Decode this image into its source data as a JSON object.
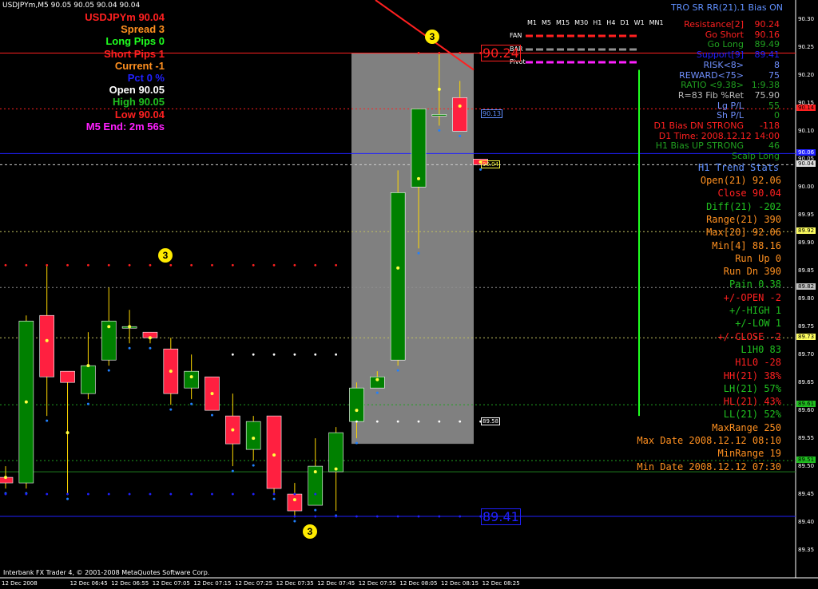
{
  "header": {
    "symbol_line": "USDJPYm,M5  90.05 90.05 90.04 90.04"
  },
  "left_panel": [
    {
      "text": "USDJPYm 90.04",
      "color": "#ff2020"
    },
    {
      "text": "Spread 3",
      "color": "#ff9020"
    },
    {
      "text": "Long Pips 0",
      "color": "#20ff20"
    },
    {
      "text": "Short Pips 1",
      "color": "#ff2020"
    },
    {
      "text": "Current -1",
      "color": "#ff9020"
    },
    {
      "text": "Pct 0 %",
      "color": "#2020ff"
    },
    {
      "text": "Open 90.05",
      "color": "#ffffff"
    },
    {
      "text": "High 90.05",
      "color": "#20c020"
    },
    {
      "text": "Low 90.04",
      "color": "#ff2020"
    },
    {
      "text": "M5 End: 2m 56s",
      "color": "#ff20ff"
    }
  ],
  "timeframes": [
    "M1",
    "M5",
    "M15",
    "M30",
    "H1",
    "H4",
    "D1",
    "W1",
    "MN1"
  ],
  "indicator_rows": [
    {
      "label": "FAN",
      "color": "#ff2020"
    },
    {
      "label": "BAR",
      "color": "#909090"
    },
    {
      "label": "Pivot",
      "color": "#ff20ff"
    }
  ],
  "trade_panel": {
    "title": "TRO SR RR(21).1  Bias ON",
    "rows": [
      {
        "k": "Resistance[2]",
        "v": "90.24",
        "kc": "#ff2020",
        "vc": "#ff2020"
      },
      {
        "k": "Go Short",
        "v": "90.16",
        "kc": "#ff2020",
        "vc": "#ff2020"
      },
      {
        "k": "Go Long",
        "v": "89.49",
        "kc": "#20a020",
        "vc": "#20a020"
      },
      {
        "k": "Support[9]",
        "v": "89.41",
        "kc": "#2020ff",
        "vc": "#2020ff"
      },
      {
        "k": "RISK<8>",
        "v": "8",
        "kc": "#7090ff",
        "vc": "#7090ff"
      },
      {
        "k": "REWARD<75>",
        "v": "75",
        "kc": "#7090ff",
        "vc": "#7090ff"
      },
      {
        "k": "RATIO <9.38>",
        "v": "1:9.38",
        "kc": "#20a020",
        "vc": "#20a020"
      },
      {
        "k": "R=83 Fib %Ret",
        "v": "75.90",
        "kc": "#bbbbbb",
        "vc": "#bbbbbb"
      },
      {
        "k": "Lg P/L",
        "v": "55",
        "kc": "#7090ff",
        "vc": "#20a020"
      },
      {
        "k": "Sh P/L",
        "v": "0",
        "kc": "#7090ff",
        "vc": "#20a020"
      },
      {
        "k": "D1 Bias DN STRONG",
        "v": "-118",
        "kc": "#ff2020",
        "vc": "#ff2020"
      },
      {
        "k": "D1 Time: 2008.12.12 14:00",
        "v": "",
        "kc": "#ff2020",
        "vc": "#ff2020"
      },
      {
        "k": "H1 Bias UP STRONG",
        "v": "46",
        "kc": "#20a020",
        "vc": "#20a020"
      },
      {
        "k": "Scalp Long",
        "v": "",
        "kc": "#20a020",
        "vc": "#20a020"
      }
    ]
  },
  "h1_stats": {
    "title": "H1 Trend Stats",
    "rows": [
      {
        "k": "Open(21)",
        "v": "92.06",
        "c": "#ff9020"
      },
      {
        "k": "Close",
        "v": "90.04",
        "c": "#ff2020"
      },
      {
        "k": "Diff(21)",
        "v": "-202",
        "c": "#20c020"
      },
      {
        "k": "Range(21)",
        "v": "390",
        "c": "#ff9020"
      },
      {
        "k": "Max[20]",
        "v": "92.06",
        "c": "#ff9020"
      },
      {
        "k": "Min[4]",
        "v": "88.16",
        "c": "#ff9020"
      },
      {
        "k": "Run Up",
        "v": "0",
        "c": "#ff9020"
      },
      {
        "k": "Run Dn",
        "v": "390",
        "c": "#ff9020"
      },
      {
        "k": "Pain",
        "v": "0.38",
        "c": "#20c020"
      },
      {
        "k": "+/-OPEN",
        "v": "-2",
        "c": "#ff2020"
      },
      {
        "k": "+/-HIGH",
        "v": "1",
        "c": "#20c020"
      },
      {
        "k": "+/-LOW",
        "v": "1",
        "c": "#20c020"
      },
      {
        "k": "+/-CLOSE",
        "v": "-2",
        "c": "#ff2020"
      },
      {
        "k": "L1H0",
        "v": "83",
        "c": "#20c020"
      },
      {
        "k": "H1L0",
        "v": "-28",
        "c": "#ff2020"
      },
      {
        "k": "HH(21)",
        "v": "38%",
        "c": "#ff2020"
      },
      {
        "k": "LH(21)",
        "v": "57%",
        "c": "#20c020"
      },
      {
        "k": "HL(21)",
        "v": "43%",
        "c": "#ff2020"
      },
      {
        "k": "LL(21)",
        "v": "52%",
        "c": "#20c020"
      },
      {
        "k": "MaxRange",
        "v": "250",
        "c": "#ff9020"
      },
      {
        "k": "Max Date",
        "v": "2008.12.12 08:10",
        "c": "#ff9020"
      },
      {
        "k": "MinRange",
        "v": "19",
        "c": "#ff9020"
      },
      {
        "k": "Min Date",
        "v": "2008.12.12 07:30",
        "c": "#ff9020"
      }
    ]
  },
  "price_axis": [
    "90.30",
    "90.25",
    "90.20",
    "90.15",
    "90.10",
    "90.05",
    "90.00",
    "89.95",
    "89.90",
    "89.85",
    "89.80",
    "89.75",
    "89.70",
    "89.65",
    "89.60",
    "89.55",
    "89.50",
    "89.45",
    "89.40",
    "89.35"
  ],
  "price_tags": [
    {
      "text": "90.14",
      "price": 90.14,
      "bg": "#ff2020",
      "fg": "#000"
    },
    {
      "text": "90.06",
      "price": 90.06,
      "bg": "#2020ff",
      "fg": "#fff"
    },
    {
      "text": "90.04",
      "price": 90.04,
      "bg": "#e0e0e0",
      "fg": "#000"
    },
    {
      "text": "89.92",
      "price": 89.92,
      "bg": "#ffff60",
      "fg": "#000"
    },
    {
      "text": "89.82",
      "price": 89.82,
      "bg": "#c0c0c0",
      "fg": "#000"
    },
    {
      "text": "89.73",
      "price": 89.73,
      "bg": "#ffff60",
      "fg": "#000"
    },
    {
      "text": "89.61",
      "price": 89.61,
      "bg": "#20c020",
      "fg": "#000"
    },
    {
      "text": "89.51",
      "price": 89.51,
      "bg": "#20c020",
      "fg": "#000"
    }
  ],
  "time_axis": [
    "12 Dec 2008",
    "12 Dec 06:45",
    "12 Dec 06:55",
    "12 Dec 07:05",
    "12 Dec 07:15",
    "12 Dec 07:25",
    "12 Dec 07:35",
    "12 Dec 07:45",
    "12 Dec 07:55",
    "12 Dec 08:05",
    "12 Dec 08:15",
    "12 Dec 08:25"
  ],
  "box_labels": [
    {
      "text": "90.24",
      "price": 90.24,
      "color": "#ff2020"
    },
    {
      "text": "90.13",
      "price": 90.13,
      "color": "#6090ff"
    },
    {
      "text": "90.04",
      "price": 90.04,
      "color": "#ffff40"
    },
    {
      "text": "89.58",
      "price": 89.58,
      "color": "#ffffff"
    },
    {
      "text": "89.41",
      "price": 89.41,
      "color": "#2020ff"
    }
  ],
  "circle_label": "3",
  "footer": "Interbank FX Trader 4, © 2001-2008 MetaQuotes Software Corp.",
  "candles": [
    {
      "o": 89.48,
      "h": 89.5,
      "l": 89.46,
      "c": 89.47
    },
    {
      "o": 89.47,
      "h": 89.77,
      "l": 89.46,
      "c": 89.76
    },
    {
      "o": 89.77,
      "h": 89.86,
      "l": 89.59,
      "c": 89.66
    },
    {
      "o": 89.67,
      "h": 89.67,
      "l": 89.45,
      "c": 89.65
    },
    {
      "o": 89.63,
      "h": 89.74,
      "l": 89.62,
      "c": 89.68
    },
    {
      "o": 89.69,
      "h": 89.82,
      "l": 89.68,
      "c": 89.76
    },
    {
      "o": 89.75,
      "h": 89.78,
      "l": 89.72,
      "c": 89.75
    },
    {
      "o": 89.74,
      "h": 89.74,
      "l": 89.72,
      "c": 89.73
    },
    {
      "o": 89.71,
      "h": 89.73,
      "l": 89.61,
      "c": 89.63
    },
    {
      "o": 89.64,
      "h": 89.7,
      "l": 89.62,
      "c": 89.67
    },
    {
      "o": 89.66,
      "h": 89.66,
      "l": 89.6,
      "c": 89.6
    },
    {
      "o": 89.59,
      "h": 89.63,
      "l": 89.5,
      "c": 89.54
    },
    {
      "o": 89.53,
      "h": 89.59,
      "l": 89.51,
      "c": 89.58
    },
    {
      "o": 89.59,
      "h": 89.59,
      "l": 89.45,
      "c": 89.46
    },
    {
      "o": 89.45,
      "h": 89.47,
      "l": 89.41,
      "c": 89.42
    },
    {
      "o": 89.43,
      "h": 89.55,
      "l": 89.43,
      "c": 89.5
    },
    {
      "o": 89.49,
      "h": 89.57,
      "l": 89.42,
      "c": 89.56
    },
    {
      "o": 89.58,
      "h": 89.65,
      "l": 89.55,
      "c": 89.64
    },
    {
      "o": 89.64,
      "h": 89.67,
      "l": 89.64,
      "c": 89.66
    },
    {
      "o": 89.69,
      "h": 90.03,
      "l": 89.68,
      "c": 89.99
    },
    {
      "o": 90.0,
      "h": 90.14,
      "l": 89.89,
      "c": 90.14
    },
    {
      "o": 90.13,
      "h": 90.24,
      "l": 90.11,
      "c": 90.13
    },
    {
      "o": 90.16,
      "h": 90.19,
      "l": 90.1,
      "c": 90.1
    },
    {
      "o": 90.05,
      "h": 90.05,
      "l": 90.04,
      "c": 90.04
    }
  ],
  "chart_meta": {
    "pmin": 89.3,
    "pmax": 90.335,
    "up_color": "#008000",
    "down_color": "#ff2040",
    "wick_color": "#ffd800"
  }
}
